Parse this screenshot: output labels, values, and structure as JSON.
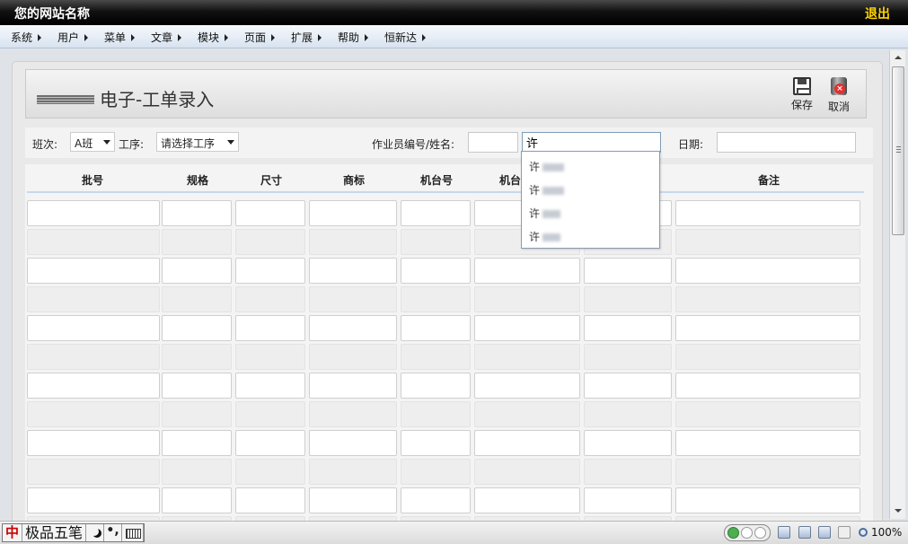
{
  "header": {
    "site_name": "您的网站名称",
    "logout_label": "退出"
  },
  "menu": [
    "系统",
    "用户",
    "菜单",
    "文章",
    "模块",
    "页面",
    "扩展",
    "帮助",
    "恒新达"
  ],
  "page": {
    "title": "电子-工单录入",
    "save_label": "保存",
    "cancel_label": "取消"
  },
  "filters": {
    "shift_label": "班次:",
    "shift_value": "A班",
    "process_label": "工序:",
    "process_value": "请选择工序",
    "worker_label": "作业员编号/姓名:",
    "worker_id_value": "",
    "worker_name_value": "许",
    "date_label": "日期:",
    "date_value": ""
  },
  "table": {
    "columns": [
      "批号",
      "规格",
      "尺寸",
      "商标",
      "机台号",
      "机台",
      "",
      "备注"
    ]
  },
  "autocomplete": {
    "items": [
      "许",
      "许",
      "许",
      "许"
    ]
  },
  "statusbar": {
    "ime_logo": "中",
    "ime_name": "极品五笔",
    "ime_punct": "•,",
    "zoom": "100%"
  },
  "colors": {
    "topbar": "#000000",
    "logout": "#ffd400",
    "menubar": "#dce6f2",
    "header_line": "#c8d8ec"
  }
}
